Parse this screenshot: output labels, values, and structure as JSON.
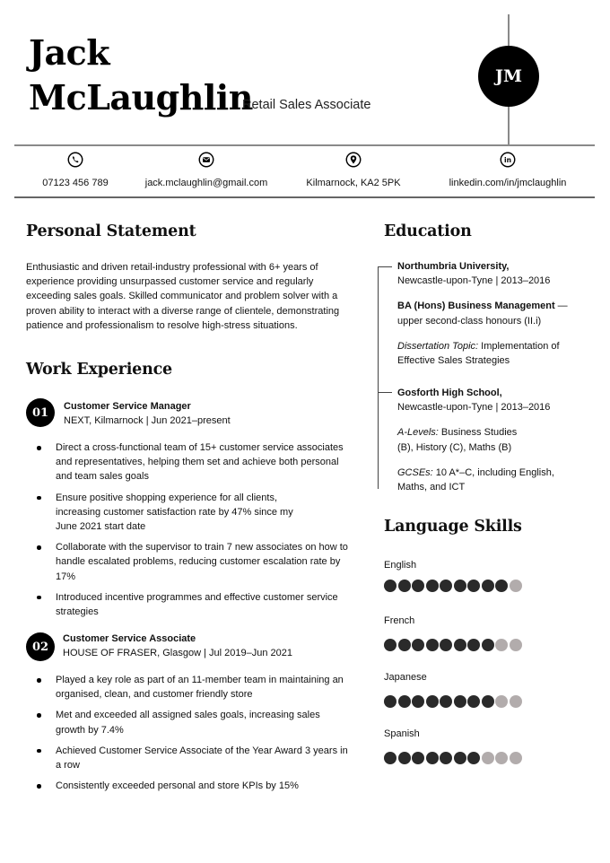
{
  "header": {
    "first_name": "Jack",
    "last_name": "McLaughlin",
    "job_title": "Retail Sales Associate",
    "monogram": "JM",
    "line_color": "#8a8a8a"
  },
  "contacts": [
    {
      "icon": "phone-icon",
      "text": "07123 456 789"
    },
    {
      "icon": "email-icon",
      "text": "jack.mclaughlin@gmail.com"
    },
    {
      "icon": "location-pin-icon",
      "text": "Kilmarnock, KA2 5PK"
    },
    {
      "icon": "linkedin-icon",
      "text": "linkedin.com/in/jmclaughlin"
    }
  ],
  "personal_statement": {
    "heading": "Personal Statement",
    "text": "Enthusiastic and driven retail-industry professional with 6+ years of experience providing unsurpassed customer service and regularly exceeding sales goals. Skilled communicator and problem solver with a proven ability to interact with a diverse range of clientele, demonstrating patience and professionalism to resolve high-stress situations."
  },
  "work_experience": {
    "heading": "Work Experience",
    "jobs": [
      {
        "number": "01",
        "title": "Customer Service Manager",
        "meta": "NEXT, Kilmarnock | Jun 2021–present",
        "bullets": [
          "Direct a cross-functional team of 15+ customer service associates and representatives, helping them set and achieve both personal and team sales goals",
          "Ensure positive shopping experience for all clients, increasing customer satisfaction rate by 47% since my June 2021 start date",
          "Collaborate with the supervisor to train 7 new associates on how to handle escalated problems, reducing customer escalation rate by 17%",
          "Introduced incentive programmes and effective customer service strategies"
        ]
      },
      {
        "number": "02",
        "title": "Customer Service Associate",
        "meta": "HOUSE OF FRASER, Glasgow | Jul 2019–Jun 2021",
        "bullets": [
          "Played a key role as part of an 11-member team in maintaining an organised, clean, and customer friendly store",
          "Met and exceeded all assigned sales goals, increasing sales growth by 7.4%",
          "Achieved Customer Service Associate of the Year Award 3 years in a row",
          "Consistently exceeded personal and store KPIs by 15%"
        ]
      }
    ]
  },
  "education": {
    "heading": "Education",
    "entries": [
      {
        "school": "Northumbria University,",
        "place_dates": "Newcastle-upon-Tyne | 2013–2016",
        "degree": "BA (Hons) Business Management",
        "degree_suffix": " —",
        "degree_detail": "upper second-class honours (II.i)",
        "extra_label": "Dissertation Topic:",
        "extra_text": " Implementation of Effective Sales Strategies"
      },
      {
        "school": "Gosforth High School,",
        "place_dates": "Newcastle-upon-Tyne | 2013–2016",
        "alevels_label": "A-Levels:",
        "alevels_text": " Business Studies (B), History (C), Maths (B)",
        "gcse_label": "GCSEs:",
        "gcse_text": " 10 A*–C, including English, Maths, and ICT"
      }
    ]
  },
  "languages": {
    "heading": "Language Skills",
    "scale_max": 10,
    "items": [
      {
        "name": "English",
        "level": 9
      },
      {
        "name": "French",
        "level": 8
      },
      {
        "name": "Japanese",
        "level": 8
      },
      {
        "name": "Spanish",
        "level": 7
      }
    ],
    "filled_color": "#2a2a2a",
    "empty_color": "#b2acac"
  }
}
